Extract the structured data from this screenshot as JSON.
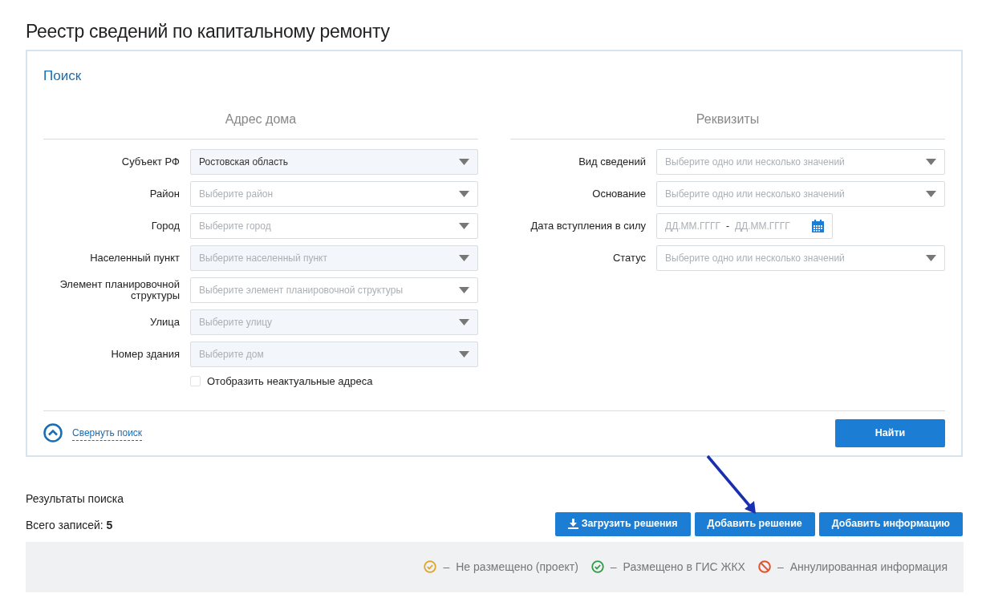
{
  "page_title": "Реестр сведений по капитальному ремонту",
  "search": {
    "title": "Поиск",
    "sections": [
      {
        "heading": "Адрес дома",
        "fields": [
          {
            "kind": "select",
            "label": "Субъект РФ",
            "value": "Ростовская область",
            "disabled": true
          },
          {
            "kind": "select",
            "label": "Район",
            "placeholder": "Выберите район",
            "disabled": false
          },
          {
            "kind": "select",
            "label": "Город",
            "placeholder": "Выберите город",
            "disabled": false
          },
          {
            "kind": "select",
            "label": "Населенный пункт",
            "placeholder": "Выберите населенный пункт",
            "disabled": true
          },
          {
            "kind": "select",
            "label": "Элемент планировочной структуры",
            "placeholder": "Выберите элемент планировочной структуры",
            "disabled": false
          },
          {
            "kind": "select",
            "label": "Улица",
            "placeholder": "Выберите улицу",
            "disabled": true
          },
          {
            "kind": "select",
            "label": "Номер здания",
            "placeholder": "Выберите дом",
            "disabled": true
          }
        ],
        "checkbox": {
          "label": "Отобразить неактуальные адреса",
          "checked": false
        }
      },
      {
        "heading": "Реквизиты",
        "fields": [
          {
            "kind": "select",
            "label": "Вид сведений",
            "placeholder": "Выберите одно или несколько значений",
            "disabled": false
          },
          {
            "kind": "select",
            "label": "Основание",
            "placeholder": "Выберите одно или несколько значений",
            "disabled": false
          },
          {
            "kind": "daterange",
            "label": "Дата вступления в силу",
            "placeholder_from": "ДД.ММ.ГГГГ",
            "separator": "-",
            "placeholder_to": "ДД.ММ.ГГГГ"
          },
          {
            "kind": "select",
            "label": "Статус",
            "placeholder": "Выберите одно или несколько значений",
            "disabled": false
          }
        ]
      }
    ],
    "collapse_link": "Свернуть поиск",
    "submit": "Найти"
  },
  "results": {
    "title": "Результаты поиска",
    "total_label": "Всего записей:",
    "total": "5",
    "buttons": [
      {
        "kind": "download",
        "label": "Загрузить решения"
      },
      {
        "kind": "plain",
        "label": "Добавить решение"
      },
      {
        "kind": "plain",
        "label": "Добавить информацию"
      }
    ],
    "legend": [
      {
        "kind": "check",
        "color": "#e0a526",
        "separator": "–",
        "label": "Не размещено (проект)"
      },
      {
        "kind": "check",
        "color": "#2e9b45",
        "separator": "–",
        "label": "Размещено в ГИС ЖКХ"
      },
      {
        "kind": "cancel",
        "color": "#e3532d",
        "separator": "–",
        "label": "Аннулированная информация"
      }
    ]
  }
}
